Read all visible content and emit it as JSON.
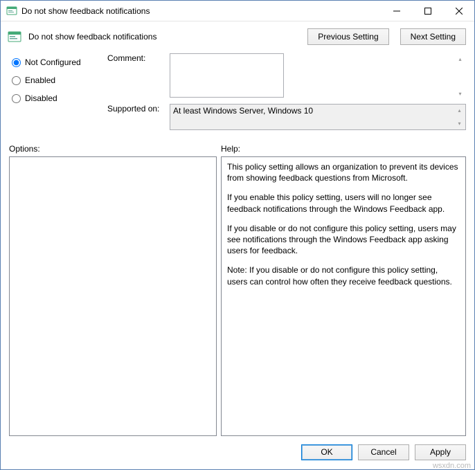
{
  "window": {
    "title": "Do not show feedback notifications"
  },
  "header": {
    "title": "Do not show feedback notifications",
    "previous_label": "Previous Setting",
    "next_label": "Next Setting"
  },
  "config": {
    "radios": {
      "not_configured": "Not Configured",
      "enabled": "Enabled",
      "disabled": "Disabled",
      "selected": "not_configured"
    },
    "comment_label": "Comment:",
    "comment_value": "",
    "supported_label": "Supported on:",
    "supported_value": "At least Windows Server, Windows 10"
  },
  "panes": {
    "options_label": "Options:",
    "help_label": "Help:",
    "help_p1": "This policy setting allows an organization to prevent its devices from showing feedback questions from Microsoft.",
    "help_p2": "If you enable this policy setting, users will no longer see feedback notifications through the Windows Feedback app.",
    "help_p3": "If you disable or do not configure this policy setting, users may see notifications through the Windows Feedback app asking users for feedback.",
    "help_p4": "Note: If you disable or do not configure this policy setting, users can control how often they receive feedback questions."
  },
  "footer": {
    "ok": "OK",
    "cancel": "Cancel",
    "apply": "Apply"
  },
  "watermark": "wsxdn.com"
}
